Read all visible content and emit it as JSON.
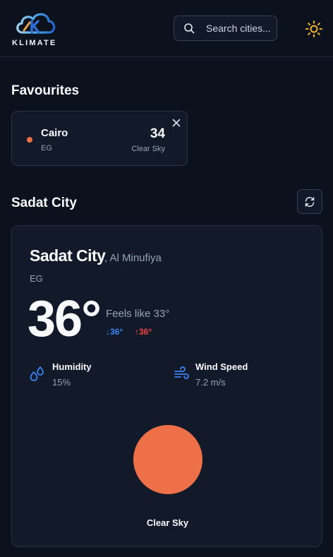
{
  "app": {
    "logo_text": "KLIMATE"
  },
  "header": {
    "search_placeholder": "Search cities..."
  },
  "favourites": {
    "title": "Favourites",
    "items": [
      {
        "city": "Cairo",
        "country": "EG",
        "temp": "34",
        "description": "Clear Sky",
        "dot_color": "#ee7049"
      }
    ]
  },
  "current": {
    "section_title": "Sadat City",
    "city": "Sadat City",
    "region": ", Al Minufiya",
    "country": "EG",
    "temp": "36°",
    "feels_like": "Feels like 33°",
    "temp_min": "↓36°",
    "temp_max": "↑36°",
    "humidity_label": "Humidity",
    "humidity_value": "15%",
    "wind_label": "Wind Speed",
    "wind_value": "7.2 m/s",
    "condition": "Clear Sky",
    "sun_color": "#ee7049"
  },
  "colors": {
    "accent_blue": "#3b82f6",
    "accent_red": "#ef4444",
    "sun_icon": "#f5b32c",
    "background": "#0b111d"
  }
}
